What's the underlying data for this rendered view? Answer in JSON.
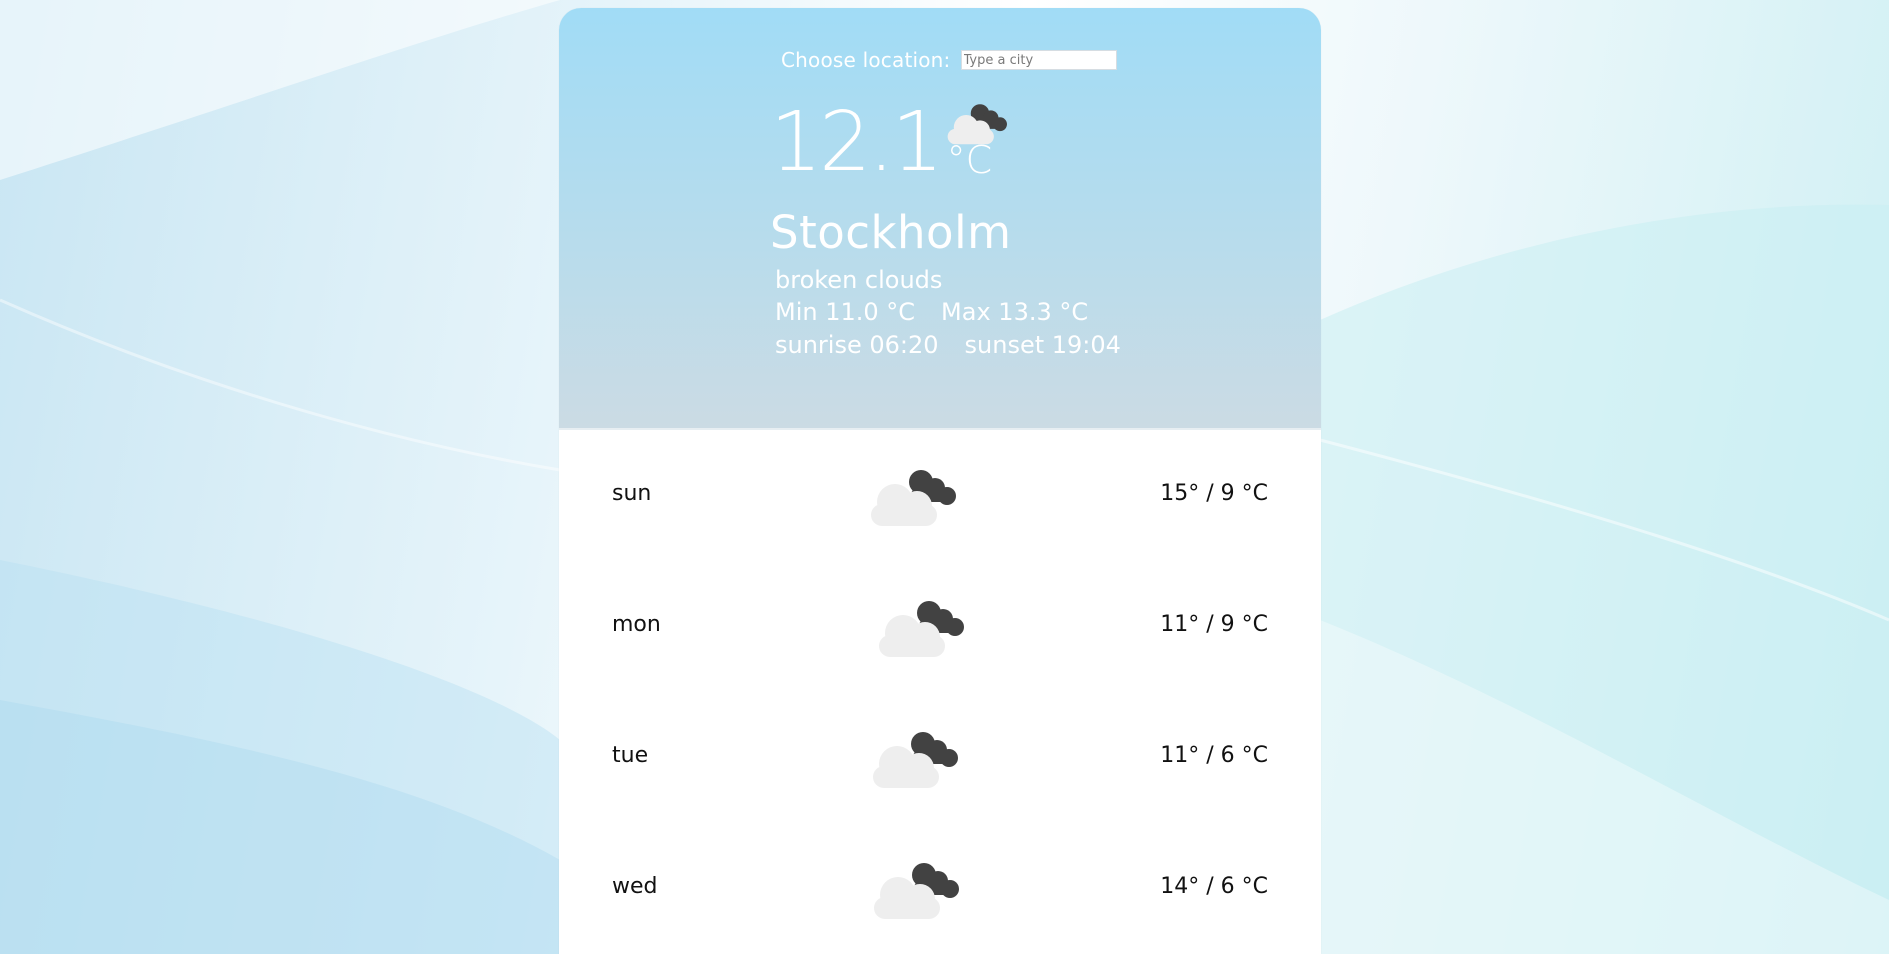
{
  "location": {
    "label": "Choose location:",
    "input_value": "",
    "input_placeholder": "Type a city"
  },
  "current": {
    "temperature": "12.1",
    "unit": "°C",
    "icon": "broken-clouds-icon",
    "city": "Stockholm",
    "description": "broken clouds",
    "min": "Min 11.0 °C",
    "max": "Max 13.3 °C",
    "sunrise": "sunrise 06:20",
    "sunset": "sunset 19:04"
  },
  "forecast": [
    {
      "day": "sun",
      "icon": "broken-clouds-icon",
      "temps": "15° / 9 °C"
    },
    {
      "day": "mon",
      "icon": "broken-clouds-icon",
      "temps": "11° / 9 °C"
    },
    {
      "day": "tue",
      "icon": "broken-clouds-icon",
      "temps": "11° / 6 °C"
    },
    {
      "day": "wed",
      "icon": "broken-clouds-icon",
      "temps": "14° / 6 °C"
    }
  ],
  "colors": {
    "hero_top": "#a1dcf6",
    "hero_bottom": "#cbdbe4",
    "dark_cloud": "#424242",
    "light_cloud": "#eeeeee"
  }
}
